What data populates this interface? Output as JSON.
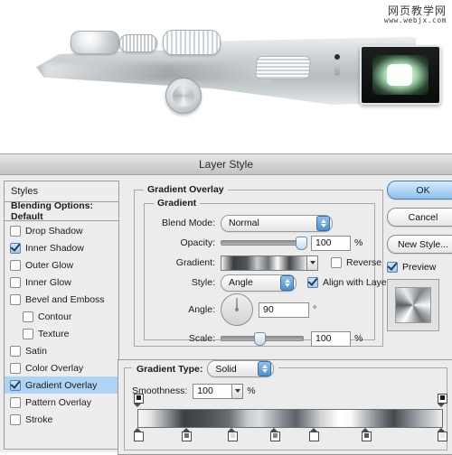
{
  "artwork": {
    "description": "top-down render of a silver compact camera",
    "watermark_cn": "网页教学网",
    "watermark_url": "www.webjx.com"
  },
  "dialog": {
    "title": "Layer Style"
  },
  "sidebar": {
    "header": "Styles",
    "blending_options": "Blending Options: Default",
    "items": [
      {
        "label": "Drop Shadow",
        "checked": false,
        "indent": false,
        "selected": false
      },
      {
        "label": "Inner Shadow",
        "checked": true,
        "indent": false,
        "selected": false
      },
      {
        "label": "Outer Glow",
        "checked": false,
        "indent": false,
        "selected": false
      },
      {
        "label": "Inner Glow",
        "checked": false,
        "indent": false,
        "selected": false
      },
      {
        "label": "Bevel and Emboss",
        "checked": false,
        "indent": false,
        "selected": false
      },
      {
        "label": "Contour",
        "checked": false,
        "indent": true,
        "selected": false
      },
      {
        "label": "Texture",
        "checked": false,
        "indent": true,
        "selected": false
      },
      {
        "label": "Satin",
        "checked": false,
        "indent": false,
        "selected": false
      },
      {
        "label": "Color Overlay",
        "checked": false,
        "indent": false,
        "selected": false
      },
      {
        "label": "Gradient Overlay",
        "checked": true,
        "indent": false,
        "selected": true
      },
      {
        "label": "Pattern Overlay",
        "checked": false,
        "indent": false,
        "selected": false
      },
      {
        "label": "Stroke",
        "checked": false,
        "indent": false,
        "selected": false
      }
    ]
  },
  "main": {
    "section_title": "Gradient Overlay",
    "group_title": "Gradient",
    "blend_mode": {
      "label": "Blend Mode:",
      "value": "Normal"
    },
    "opacity": {
      "label": "Opacity:",
      "value": "100",
      "unit": "%",
      "percent": 100
    },
    "gradient": {
      "label": "Gradient:",
      "reverse_label": "Reverse",
      "reverse_checked": false
    },
    "style": {
      "label": "Style:",
      "value": "Angle",
      "align_label": "Align with Layer",
      "align_checked": true
    },
    "angle": {
      "label": "Angle:",
      "value": "90",
      "unit": "°"
    },
    "scale": {
      "label": "Scale:",
      "value": "100",
      "unit": "%",
      "percent": 45
    }
  },
  "gradient_editor": {
    "type_label": "Gradient Type:",
    "type_value": "Solid",
    "smoothness_label": "Smoothness:",
    "smoothness_value": "100",
    "smoothness_unit": "%",
    "opacity_stops": [
      {
        "position": 0
      },
      {
        "position": 100
      }
    ],
    "color_stops": [
      {
        "position": 0,
        "color": "#ffffff"
      },
      {
        "position": 16,
        "color": "#6b6f73"
      },
      {
        "position": 31,
        "color": "#d9dcde"
      },
      {
        "position": 45,
        "color": "#7e8286"
      },
      {
        "position": 58,
        "color": "#ffffff"
      },
      {
        "position": 75,
        "color": "#54585c"
      },
      {
        "position": 100,
        "color": "#e6e8ea"
      }
    ]
  },
  "buttons": {
    "ok": "OK",
    "cancel": "Cancel",
    "new_style": "New Style...",
    "preview_label": "Preview",
    "preview_checked": true
  }
}
